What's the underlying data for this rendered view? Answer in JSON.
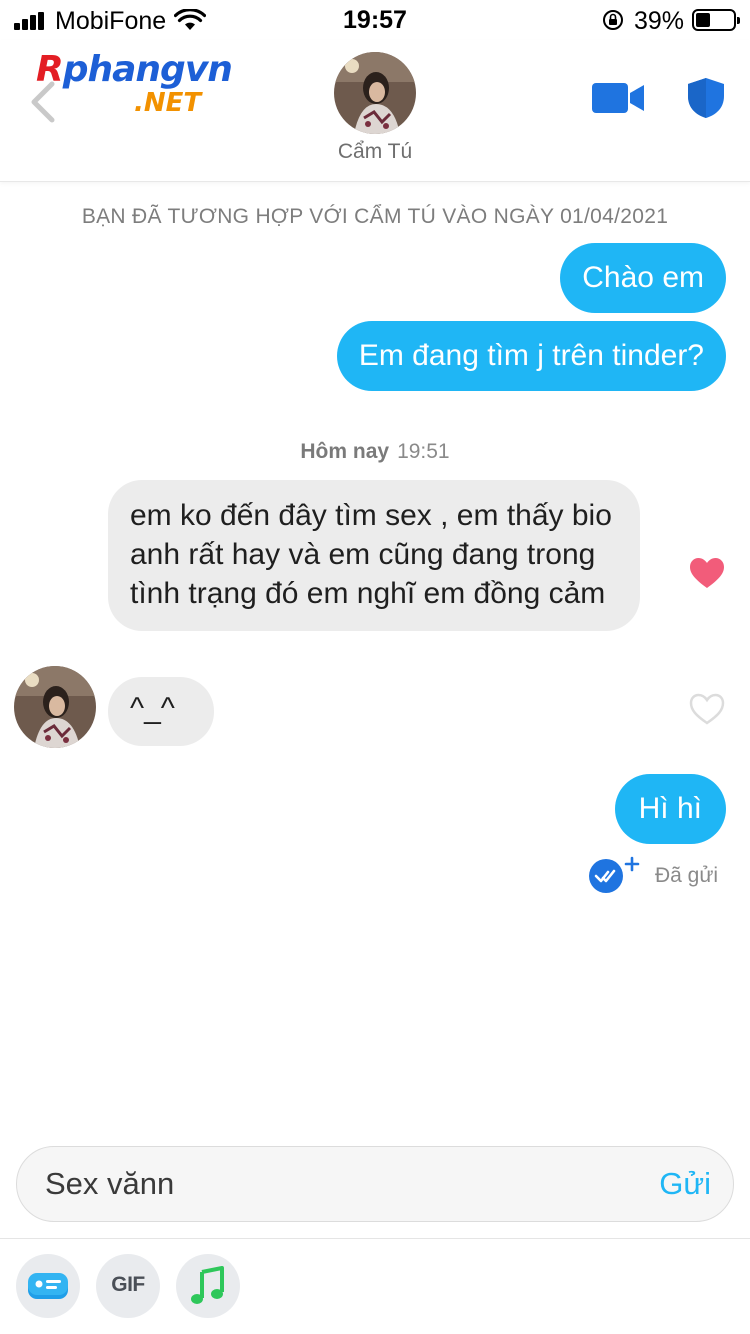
{
  "status_bar": {
    "carrier": "MobiFone",
    "time": "19:57",
    "battery_percent": "39%",
    "battery_level": 0.39
  },
  "header": {
    "watermark_text": "Rphangvn .NET",
    "contact_name": "Cẩm Tú",
    "icons": [
      "back-chevron-icon",
      "video-call-icon",
      "safety-shield-icon"
    ],
    "accent_color": "#1f74e0"
  },
  "chat": {
    "match_notice": "BẠN ĐÃ TƯƠNG HỢP VỚI CẨM TÚ VÀO NGÀY 01/04/2021",
    "day_label": "Hôm nay",
    "day_time": "19:51",
    "messages": [
      {
        "side": "out",
        "text": "Chào em"
      },
      {
        "side": "out",
        "text": "Em đang tìm j trên tinder?"
      },
      {
        "side": "in",
        "text": "em ko đến đây tìm sex , em thấy bio anh rất hay và em cũng đang trong tình trạng đó em nghĩ em đồng cảm",
        "liked": true
      },
      {
        "side": "in",
        "text": "^_^",
        "liked": false
      },
      {
        "side": "out",
        "text": "Hì hì"
      }
    ],
    "sent_status": "Đã gửi",
    "outgoing_color": "#1fb6f5",
    "incoming_color": "#ececec"
  },
  "composer": {
    "value": "Sex vănn",
    "send_label": "Gửi"
  },
  "toolbar": {
    "gif_label": "GIF",
    "icons": [
      "sticker-card-icon",
      "gif-icon",
      "music-note-icon"
    ]
  }
}
